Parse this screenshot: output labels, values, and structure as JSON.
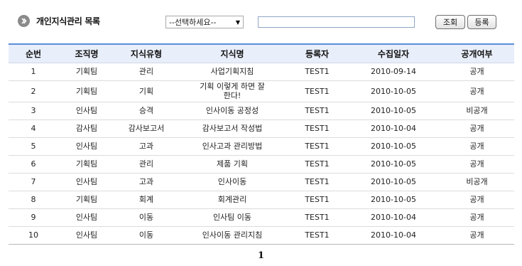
{
  "header": {
    "title": "개인지식관리 목록",
    "select_value": "--선택하세요--",
    "search_value": "",
    "search_button": "조회",
    "register_button": "등록"
  },
  "table": {
    "columns": [
      "순번",
      "조직명",
      "지식유형",
      "지식명",
      "등록자",
      "수집일자",
      "공개여부"
    ],
    "rows": [
      {
        "no": "1",
        "org": "기획팀",
        "type": "관리",
        "name": "사업기획지침",
        "author": "TEST1",
        "date": "2010-09-14",
        "public": "공개"
      },
      {
        "no": "2",
        "org": "기획팀",
        "type": "기획",
        "name": "기획 이렇게 하면 잘 한다!",
        "author": "TEST1",
        "date": "2010-10-05",
        "public": "공개"
      },
      {
        "no": "3",
        "org": "인사팀",
        "type": "승격",
        "name": "인사이동 공정성",
        "author": "TEST1",
        "date": "2010-10-05",
        "public": "비공개"
      },
      {
        "no": "4",
        "org": "감사팀",
        "type": "감사보고서",
        "name": "감사보고서 작성법",
        "author": "TEST1",
        "date": "2010-10-04",
        "public": "공개"
      },
      {
        "no": "5",
        "org": "인사팀",
        "type": "고과",
        "name": "인사고과 관리방법",
        "author": "TEST1",
        "date": "2010-10-05",
        "public": "공개"
      },
      {
        "no": "6",
        "org": "기획팀",
        "type": "관리",
        "name": "제품 기획",
        "author": "TEST1",
        "date": "2010-10-05",
        "public": "공개"
      },
      {
        "no": "7",
        "org": "인사팀",
        "type": "고과",
        "name": "인사이동",
        "author": "TEST1",
        "date": "2010-10-05",
        "public": "비공개"
      },
      {
        "no": "8",
        "org": "기획팀",
        "type": "회계",
        "name": "회계관리",
        "author": "TEST1",
        "date": "2010-10-05",
        "public": "공개"
      },
      {
        "no": "9",
        "org": "인사팀",
        "type": "이동",
        "name": "인사팀 이동",
        "author": "TEST1",
        "date": "2010-10-04",
        "public": "공개"
      },
      {
        "no": "10",
        "org": "인사팀",
        "type": "이동",
        "name": "인사이동 관리지침",
        "author": "TEST1",
        "date": "2010-10-04",
        "public": "공개"
      }
    ]
  },
  "pagination": {
    "current_page": "1"
  },
  "icons": {
    "title_bullet": "chevron-right-circle-icon",
    "select_arrow": "triangle-down-icon"
  },
  "colors": {
    "header_bg": "#e8eefa",
    "header_border": "#5a8ed6",
    "bullet": "#8a8a8a"
  }
}
